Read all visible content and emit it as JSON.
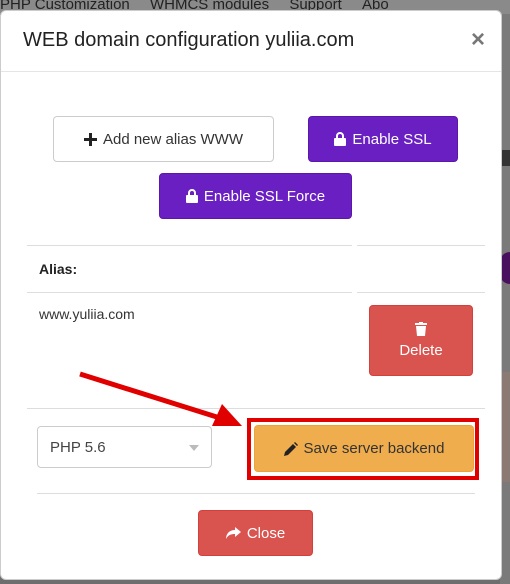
{
  "background_nav": {
    "items": [
      "PHP Customization",
      "WHMCS modules",
      "Support",
      "Abo"
    ]
  },
  "modal": {
    "title": "WEB domain configuration yuliia.com",
    "close_symbol": "×"
  },
  "actions": {
    "add_alias_label": "Add new alias WWW",
    "enable_ssl_label": "Enable SSL",
    "enable_ssl_force_label": "Enable SSL Force"
  },
  "alias_table": {
    "header": "Alias:",
    "rows": [
      {
        "alias": "www.yuliia.com",
        "delete_label": "Delete"
      }
    ]
  },
  "backend": {
    "php_select_value": "PHP 5.6",
    "save_label": "Save server backend"
  },
  "footer": {
    "close_label": "Close"
  },
  "colors": {
    "purple": "#6a1fc2",
    "danger": "#d9534f",
    "warning": "#f0ad4e",
    "annotation_red": "#e00000"
  },
  "icons": {
    "add_alias": "plus-icon",
    "ssl": "lock-icon",
    "ssl_force": "lock-icon",
    "delete": "trash-icon",
    "save": "pencil-icon",
    "close": "share-arrow-icon"
  }
}
